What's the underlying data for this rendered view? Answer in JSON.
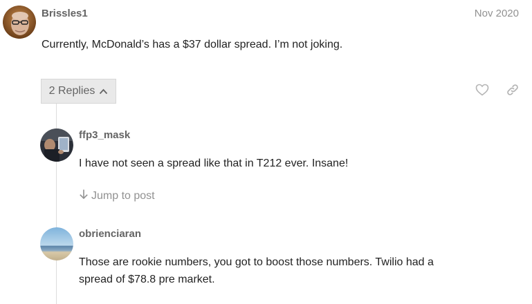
{
  "post": {
    "username": "Brissles1",
    "date": "Nov 2020",
    "text": "Currently, McDonald’s has a $37 dollar spread. I’m not joking."
  },
  "replies_button": {
    "label": "2 Replies"
  },
  "icons": {
    "like": "heart-icon",
    "share": "link-icon",
    "expand": "chevron-up-icon",
    "jump": "arrow-down-icon"
  },
  "replies": [
    {
      "username": "ffp3_mask",
      "text": "I have not seen a spread like that in T212 ever. Insane!",
      "jump_label": "Jump to post"
    },
    {
      "username": "obrienciaran",
      "text_line1": "Those are rookie numbers, you got to boost those numbers. Twilio had a",
      "text_line2": "spread of $78.8 pre market."
    }
  ],
  "colors": {
    "username": "#646464",
    "muted": "#919191",
    "body_text": "#222222",
    "button_bg": "#e9e9e9",
    "thread_line": "#dddddd"
  }
}
